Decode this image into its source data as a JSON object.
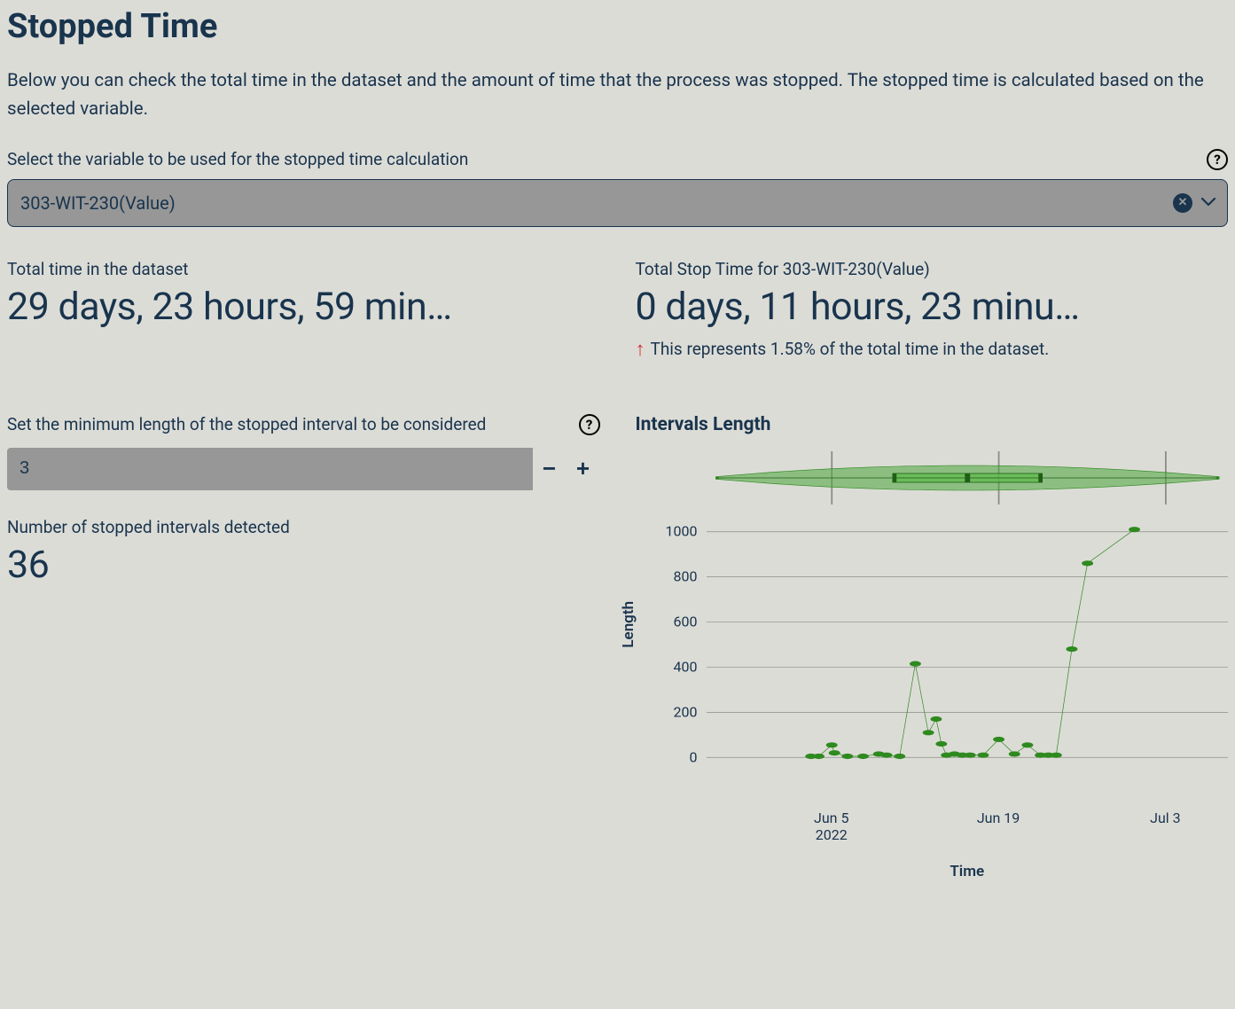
{
  "header": {
    "title": "Stopped Time",
    "description": "Below you can check the total time in the dataset and the amount of time that the process was stopped. The stopped time is calculated based on the selected variable."
  },
  "variable_select": {
    "label": "Select the variable to be used for the stopped time calculation",
    "value": "303-WIT-230(Value)"
  },
  "metrics": {
    "total_time_label": "Total time in the dataset",
    "total_time_value": "29 days, 23 hours, 59 min…",
    "stop_time_label": "Total Stop Time for 303-WIT-230(Value)",
    "stop_time_value": "0 days, 11 hours, 23 minu…",
    "percent_text": "This represents 1.58% of the total time in the dataset."
  },
  "min_length": {
    "label": "Set the minimum length of the stopped interval to be considered",
    "value": "3"
  },
  "intervals_detected": {
    "label": "Number of stopped intervals detected",
    "value": "36"
  },
  "chart": {
    "heading": "Intervals Length",
    "xlabel": "Time",
    "ylabel": "Length"
  },
  "chart_data": {
    "scatter": {
      "type": "scatter",
      "title": "Intervals Length",
      "xlabel": "Time",
      "ylabel": "Length",
      "ylim": [
        -50,
        1050
      ],
      "yticks": [
        0,
        200,
        400,
        600,
        800,
        1000
      ],
      "xticks": [
        {
          "pos": 0.24,
          "label": "Jun 5",
          "sublabel": "2022"
        },
        {
          "pos": 0.56,
          "label": "Jun 19",
          "sublabel": ""
        },
        {
          "pos": 0.88,
          "label": "Jul 3",
          "sublabel": ""
        }
      ],
      "grid_x": [
        0.24,
        0.56,
        0.88
      ],
      "points": [
        {
          "x": 0.2,
          "y": 5
        },
        {
          "x": 0.215,
          "y": 5
        },
        {
          "x": 0.24,
          "y": 55
        },
        {
          "x": 0.245,
          "y": 20
        },
        {
          "x": 0.27,
          "y": 5
        },
        {
          "x": 0.3,
          "y": 5
        },
        {
          "x": 0.33,
          "y": 15
        },
        {
          "x": 0.345,
          "y": 10
        },
        {
          "x": 0.37,
          "y": 5
        },
        {
          "x": 0.4,
          "y": 415
        },
        {
          "x": 0.425,
          "y": 110
        },
        {
          "x": 0.44,
          "y": 170
        },
        {
          "x": 0.45,
          "y": 60
        },
        {
          "x": 0.46,
          "y": 10
        },
        {
          "x": 0.475,
          "y": 15
        },
        {
          "x": 0.49,
          "y": 10
        },
        {
          "x": 0.505,
          "y": 10
        },
        {
          "x": 0.53,
          "y": 10
        },
        {
          "x": 0.56,
          "y": 80
        },
        {
          "x": 0.59,
          "y": 15
        },
        {
          "x": 0.615,
          "y": 55
        },
        {
          "x": 0.64,
          "y": 10
        },
        {
          "x": 0.655,
          "y": 10
        },
        {
          "x": 0.67,
          "y": 10
        },
        {
          "x": 0.7,
          "y": 480
        },
        {
          "x": 0.73,
          "y": 860
        },
        {
          "x": 0.82,
          "y": 1010
        }
      ]
    },
    "violin": {
      "type": "violin",
      "min": 0.02,
      "q1": 0.36,
      "median": 0.5,
      "q3": 0.64,
      "max": 0.98
    }
  }
}
